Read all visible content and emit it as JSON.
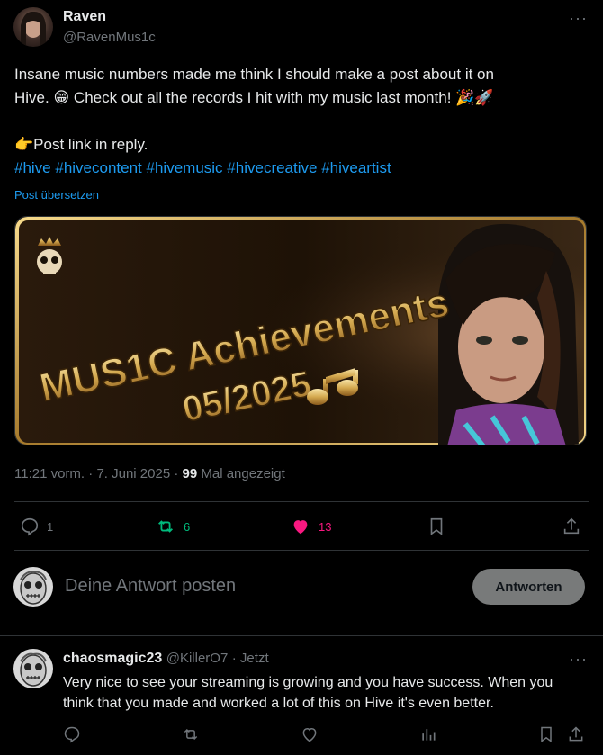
{
  "post": {
    "author_name": "Raven",
    "author_handle": "@RavenMus1c",
    "more": "···",
    "text_line1": "Insane music numbers made me think I should make a post about it on",
    "text_line2_a": "Hive. ",
    "emoji_grin": "😁",
    "text_line2_b": " Check out all the records I hit with my music last month! ",
    "emoji_party": "🎉",
    "emoji_rocket": "🚀",
    "emoji_point": "👉",
    "post_link": "Post link in reply.",
    "hashtags": [
      "#hive",
      "#hivecontent",
      "#hivemusic",
      "#hivecreative",
      "#hiveartist"
    ],
    "translate": "Post übersetzen",
    "image": {
      "line1": "MUS1C Achievements",
      "line2": "05/2025",
      "crown_icon": "crown-skull-icon",
      "note_icon": "music-note-icon"
    },
    "time": "11:21 vorm.",
    "date": "7. Juni 2025",
    "views_count": "99",
    "views_label": "Mal angezeigt",
    "replies": "1",
    "reposts": "6",
    "likes": "13",
    "colors": {
      "repost": "#00ba7c",
      "like": "#f91880",
      "link": "#1d9bf0"
    }
  },
  "composer": {
    "placeholder": "Deine Antwort posten",
    "button": "Antworten"
  },
  "reply": {
    "author_name": "chaosmagic23",
    "author_handle": "@KillerO7",
    "time": "· Jetzt",
    "more": "···",
    "text_line1": "Very nice to see your streaming is growing and you have success. When you",
    "text_line2": "think that you made and worked a lot of this on Hive it's even better."
  }
}
